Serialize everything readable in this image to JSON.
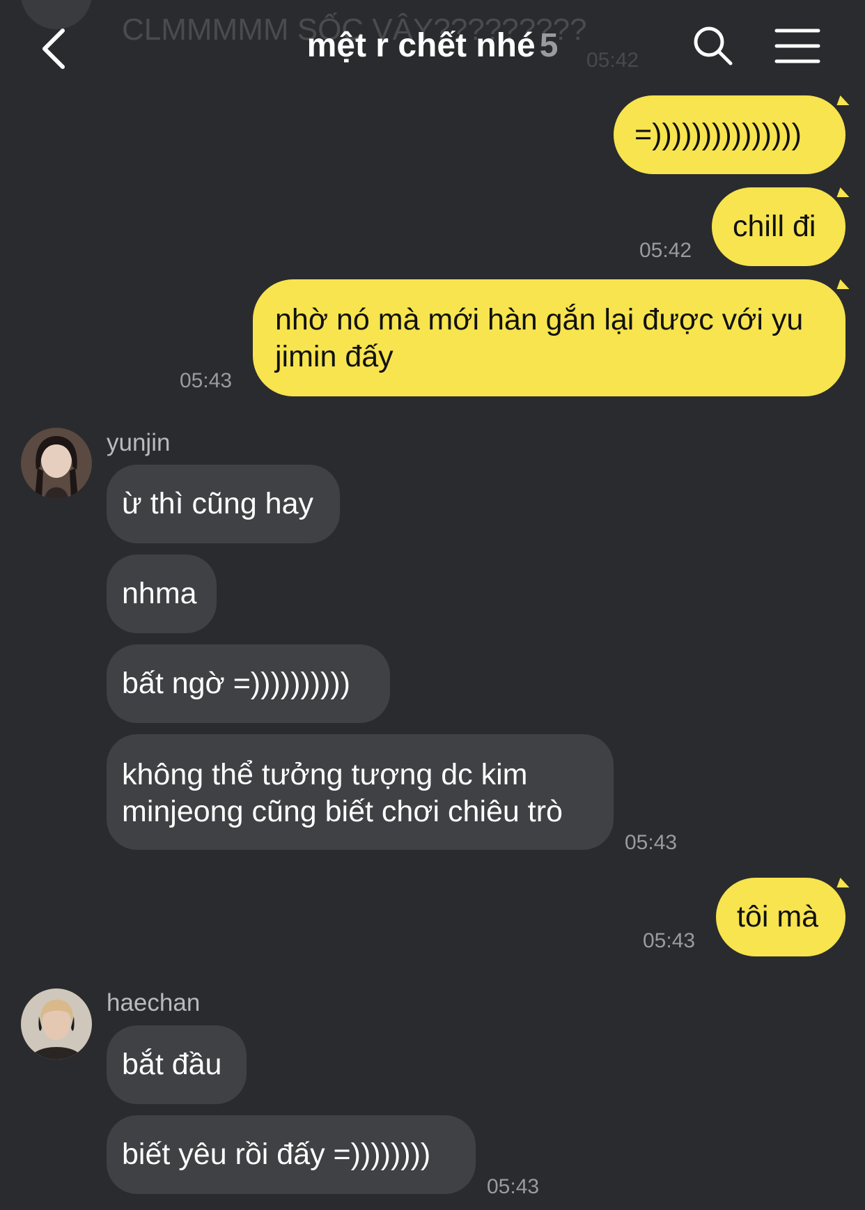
{
  "background_message": {
    "text": "CLMMMMM SỐC VẬY?????????",
    "time": "05:42"
  },
  "header": {
    "title": "mệt r chết nhé",
    "member_count": "5",
    "icons": {
      "back": "chevron-left-icon",
      "search": "search-icon",
      "menu": "hamburger-menu-icon"
    }
  },
  "messages": {
    "m1": {
      "text": "=)))))))))))))))"
    },
    "m2": {
      "text": "chill đi",
      "time": "05:42"
    },
    "m3": {
      "line1": "nhờ nó mà mới hàn gắn lại được với yu",
      "line2": "jimin đấy",
      "time": "05:43"
    },
    "yunjin": {
      "sender": "yunjin",
      "b1": "ừ thì cũng hay",
      "b2": "nhma",
      "b3": "bất ngờ =))))))))))",
      "b4_line1": "không thể tưởng tượng dc kim",
      "b4_line2": "minjeong cũng biết chơi chiêu trò",
      "time": "05:43"
    },
    "m4": {
      "text": "tôi mà",
      "time": "05:43"
    },
    "haechan": {
      "sender": "haechan",
      "b1": "bắt đầu",
      "b2": "biết yêu rồi đấy =))))))))",
      "time": "05:43"
    }
  },
  "colors": {
    "background": "#2a2b2e",
    "my_bubble": "#f7e44e",
    "other_bubble": "#404144",
    "timestamp": "#9a9b9e"
  }
}
